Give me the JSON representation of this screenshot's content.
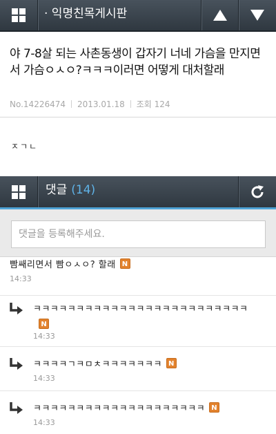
{
  "topbar": {
    "board_title": "· 익명친목게시판",
    "icons": {
      "menu": "grid-icon",
      "up": "triangle-up-icon",
      "down": "triangle-down-icon"
    }
  },
  "post": {
    "title": "야 7-8살 되는 사촌동생이 갑자기 너네 가슴을 만지면서 가슴ㅇㅅㅇ?ㅋㅋㅋ이러면 어떻게 대처할래",
    "number": "No.14226474",
    "date": "2013.01.18",
    "views": "조회 124",
    "content": "ㅈㄱㄴ"
  },
  "comments_bar": {
    "label": "댓글",
    "count": "(14)",
    "icons": {
      "menu": "grid-icon",
      "refresh": "refresh-icon"
    }
  },
  "comment_input": {
    "placeholder": "댓글을 등록해주세요."
  },
  "comments": [
    {
      "text": "빰쌔리면서 빰ㅇㅅㅇ? 할래",
      "badge": "N",
      "time": "14:33"
    },
    {
      "text": "ㅋㅋㅋㅋㅋㅋㅋㅋㅋㅋㅋㅋㅋㅋㅋㅋㅋㅋㅋㅋㅋㅋㅋㅋㅋ",
      "badge": "N",
      "time": "14:33"
    },
    {
      "text": "ㅋㅋㅋㅋㄱㅋㅁㅊㅋㅋㅋㅋㅋㅋㅋ",
      "badge": "N",
      "time": "14:33"
    },
    {
      "text": "ㅋㅋㅋㅋㅋㅋㅋㅋㅋㅋㅋㅋㅋㅋㅋㅋㅋㅋㅋㅋ",
      "badge": "N",
      "time": "14:33"
    }
  ],
  "colors": {
    "header_bg": "#3b444d",
    "accent_blue": "#4ea3d6",
    "new_badge": "#e2822d"
  }
}
